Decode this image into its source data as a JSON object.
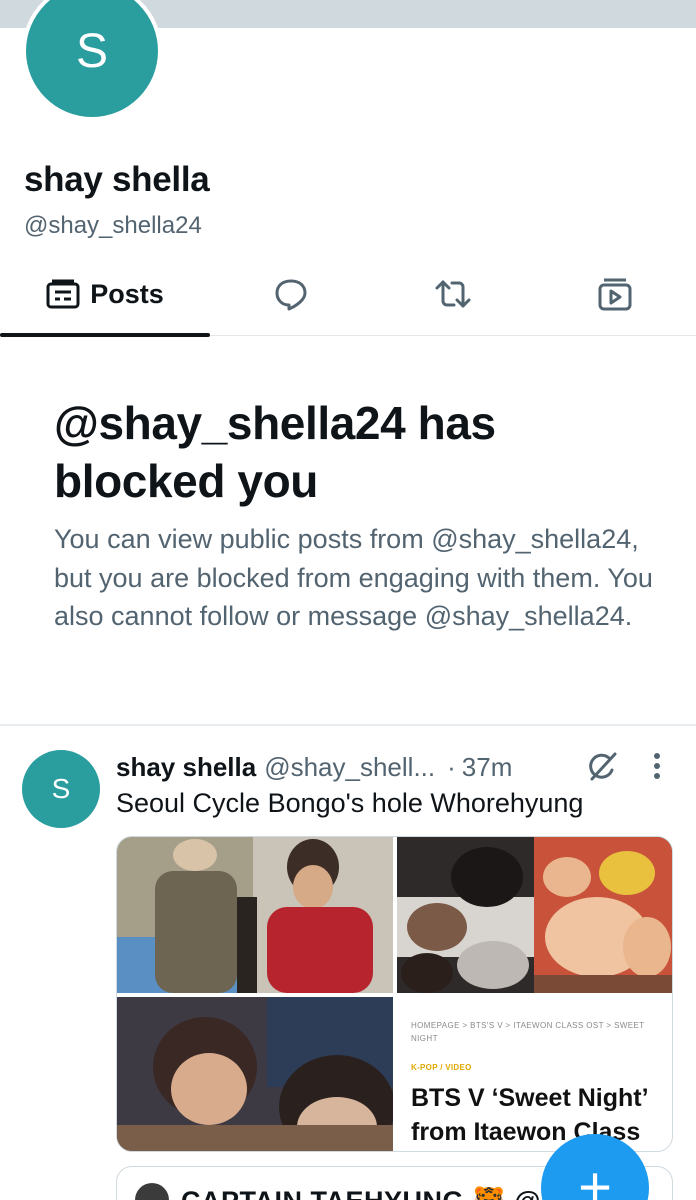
{
  "profile": {
    "avatar_letter": "S",
    "name": "shay shella",
    "handle": "@shay_shella24"
  },
  "tabs": {
    "posts_label": "Posts",
    "active": "posts",
    "icons": [
      "posts-icon",
      "replies-icon",
      "reposts-icon",
      "media-icon"
    ]
  },
  "blocked": {
    "title": "@shay_shella24 has blocked you",
    "description": "You can view public posts from @shay_shella24, but you are blocked from engaging with them. You also cannot follow or message @shay_shella24."
  },
  "post": {
    "avatar_letter": "S",
    "name": "shay shella",
    "handle": "@shay_shell...",
    "separator": "·",
    "time": "37m",
    "text": "Seoul Cycle Bongo's hole Whorehyung",
    "link_card": {
      "breadcrumbs": "HOMEPAGE  >  BTS'S V  >  ITAEWON CLASS OST  >  SWEET NIGHT",
      "category": "K-POP / VIDEO",
      "title": "BTS V ‘Sweet Night’ from Itaewon Class"
    }
  },
  "quote": {
    "text": "CAPTAIN TAEHYUNG 🐯 @"
  },
  "fab": {
    "label": "+"
  },
  "colors": {
    "accent": "#1d9bf0",
    "avatar": "#2a9d9f",
    "secondary_text": "#536471",
    "banner": "#cfd9de"
  }
}
